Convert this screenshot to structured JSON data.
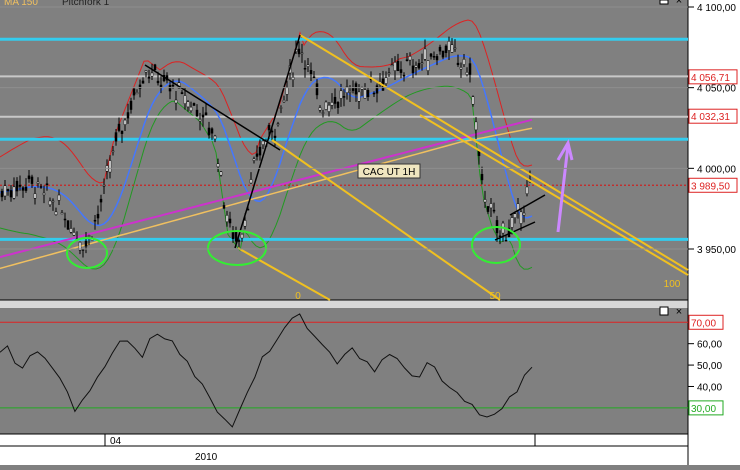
{
  "header": {
    "indicator_1": "MA 150",
    "indicator_2": "Pitchfork 1"
  },
  "chart_data": [
    {
      "type": "line",
      "title": "CAC UT 1H",
      "instrument": "CAC",
      "timeframe": "1H",
      "ylim": [
        3925,
        4108
      ],
      "price_ticks": [
        {
          "value": 4100,
          "label": "4 100,00"
        },
        {
          "value": 4050,
          "label": "4 050,00"
        },
        {
          "value": 4000,
          "label": "4 000,00"
        },
        {
          "value": 3950,
          "label": "3 950,00"
        }
      ],
      "price_markers": [
        {
          "value": 4056.71,
          "label": "4 056,71"
        },
        {
          "value": 4032.31,
          "label": "4 032,31"
        },
        {
          "value": 3989.5,
          "label": "3 989,50"
        }
      ],
      "horizontal_levels": [
        {
          "value": 4080,
          "color": "#33ccee",
          "kind": "resistance"
        },
        {
          "value": 4057,
          "color": "#c8c8c8",
          "kind": "level"
        },
        {
          "value": 4032,
          "color": "#c8c8c8",
          "kind": "level"
        },
        {
          "value": 4018,
          "color": "#33ccee",
          "kind": "support"
        },
        {
          "value": 3989.5,
          "color": "#cc2222",
          "kind": "last-price-dotted"
        },
        {
          "value": 3956,
          "color": "#33ccee",
          "kind": "support"
        }
      ],
      "pitchfork_labels": [
        "0",
        "50",
        "100"
      ],
      "series": [
        {
          "name": "MA 150",
          "color": "#f0c060"
        },
        {
          "color": "#cc33cc"
        },
        {
          "color": "#4477ff"
        },
        {
          "color": "#dd2222"
        },
        {
          "color": "#229922"
        }
      ],
      "grid": true,
      "annotations": [
        "green-circles",
        "purple-up-arrow"
      ]
    },
    {
      "type": "line",
      "title": "",
      "ylim": [
        20,
        75
      ],
      "ticks": [
        {
          "value": 60,
          "label": "60,00"
        },
        {
          "value": 50,
          "label": "50,00"
        },
        {
          "value": 40,
          "label": "40,00"
        }
      ],
      "levels": [
        {
          "value": 70,
          "label": "70,00",
          "color": "#dd2222"
        },
        {
          "value": 30,
          "label": "30,00",
          "color": "#22aa22"
        }
      ],
      "values": [
        55,
        58,
        52,
        50,
        54,
        56,
        53,
        47,
        44,
        38,
        30,
        34,
        40,
        44,
        48,
        54,
        60,
        63,
        58,
        55,
        62,
        66,
        64,
        60,
        56,
        50,
        46,
        42,
        36,
        30,
        24,
        22,
        28,
        36,
        44,
        52,
        58,
        62,
        66,
        70,
        74,
        69,
        62,
        58,
        55,
        52,
        56,
        58,
        54,
        50,
        46,
        52,
        56,
        52,
        48,
        44,
        46,
        50,
        48,
        44,
        40,
        36,
        34,
        30,
        28,
        24,
        26,
        30,
        35,
        38,
        44,
        49
      ]
    }
  ],
  "time_axis": {
    "labels": [
      "04",
      "2010"
    ]
  },
  "controls": {
    "close": "×"
  }
}
